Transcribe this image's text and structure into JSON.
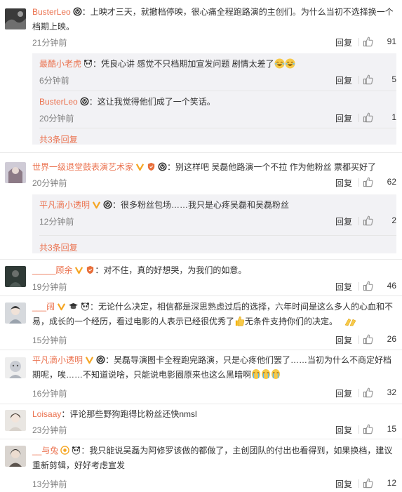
{
  "ui": {
    "reply_label": "回复",
    "colors": {
      "username": "#eb7350",
      "text": "#333333",
      "meta": "#808080",
      "subbox": "#f2f2f5"
    },
    "icons": {
      "like": "thumbs-up-icon",
      "verified": "verified-badge-icon",
      "vip": "vip-crown-icon"
    }
  },
  "comments": [
    {
      "user": "BusterLeo",
      "text_line1": "：上映才三天，就撤档停映，很心痛全程跑路演的主创们。为什么当初不选择换一个",
      "text_line2": "档期上映。",
      "time": "21分钟前",
      "likes": "91",
      "subreplies": [
        {
          "user": "最酷小老虎",
          "text": "：凭良心讲 感觉不只档期加宣发问题 剧情太差了",
          "time": "6分钟前",
          "likes": "5"
        },
        {
          "user": "BusterLeo",
          "text": "：这让我觉得他们成了一个笑话。",
          "time": "20分钟前",
          "likes": "1"
        }
      ],
      "more": "共3条回复"
    },
    {
      "user": "世界一级退堂鼓表演艺术家",
      "text_line1": "：别这样吧 吴磊他路演一个不拉 作为他粉丝 票都买好了",
      "time": "20分钟前",
      "likes": "62",
      "subreplies": [
        {
          "user": "平凡滴小透明",
          "text": "：很多粉丝包场……我只是心疼吴磊和吴磊粉丝",
          "time": "12分钟前",
          "likes": "2"
        }
      ],
      "more": "共3条回复"
    },
    {
      "user": "_____顾余",
      "text_line1": "：对不住，真的好想哭，为我们的如意。",
      "time": "19分钟前",
      "likes": "46"
    },
    {
      "user": "___阔",
      "text_line1": "：无论什么决定，相信都是深思熟虑过后的选择，六年时间是这么多人的心血和不",
      "text_line2a": "易，成长的一个经历，看过电影的人表示已经很优秀了",
      "text_line2b": "无条件支持你们的决定。",
      "time": "15分钟前",
      "likes": "26"
    },
    {
      "user": "平凡滴小透明",
      "text_line1": "：吴磊导演图卡全程跑完路演，只是心疼他们罢了……当初为什么不商定好档",
      "text_line2": "期呢，唉……不知道说啥，只能说电影圈原来也这么黑暗啊",
      "time": "16分钟前",
      "likes": "32"
    },
    {
      "user": "Loisaay",
      "text_line1": "：评论那些野狗跑得比粉丝还快nmsl",
      "time": "23分钟前",
      "likes": "15"
    },
    {
      "user": "__与兔",
      "text_line1": "：我只能说吴磊为阿修罗该做的都做了，主创团队的付出也看得到，如果换档，建议",
      "text_line2": "重新剪辑，好好考虑宣发",
      "time": "13分钟前",
      "likes": "12"
    }
  ]
}
